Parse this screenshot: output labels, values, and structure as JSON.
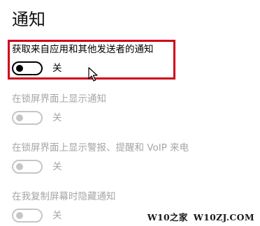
{
  "page": {
    "title": "通知"
  },
  "settings": [
    {
      "label": "获取来自应用和其他发送者的通知",
      "state": "关",
      "on": false,
      "enabled": true,
      "highlighted": true
    },
    {
      "label": "在锁屏界面上显示通知",
      "state": "关",
      "on": false,
      "enabled": false
    },
    {
      "label": "在锁屏界面上显示警报、提醒和 VoIP 来电",
      "state": "关",
      "on": false,
      "enabled": false
    },
    {
      "label": "在我复制屏幕时隐藏通知",
      "state": "关",
      "on": false,
      "enabled": false
    }
  ],
  "watermark": {
    "left": "W10之家",
    "right": "W10ZJ.COM"
  },
  "colors": {
    "highlight_border": "#d0021b",
    "disabled_text": "#a6a6a6",
    "disabled_toggle": "#c6c6c6"
  }
}
